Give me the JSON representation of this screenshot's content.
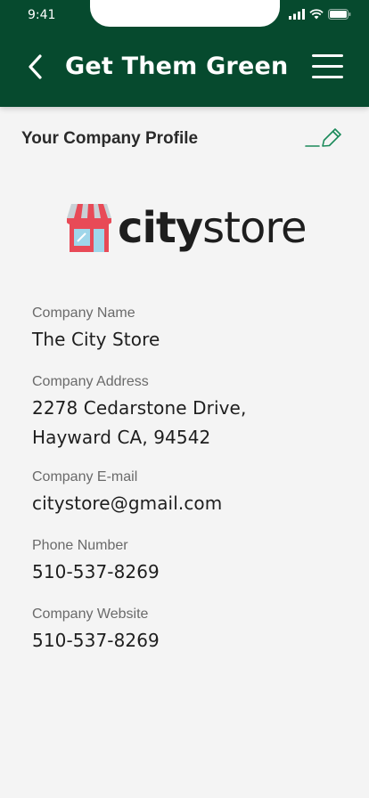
{
  "status_bar": {
    "time": "9:41"
  },
  "header": {
    "title": "Get Them Green",
    "background_color": "#064a2e"
  },
  "profile": {
    "section_title": "Your Company Profile",
    "accent_color": "#1b8a5a"
  },
  "logo": {
    "text_bold": "city",
    "text_light": "store"
  },
  "fields": [
    {
      "label": "Company Name",
      "value": "The City Store"
    },
    {
      "label": "Company Address",
      "value": "2278 Cedarstone Drive, Hayward CA, 94542"
    },
    {
      "label": "Company E-mail",
      "value": "citystore@gmail.com"
    },
    {
      "label": "Phone Number",
      "value": "510-537-8269"
    },
    {
      "label": "Company Website",
      "value": "510-537-8269"
    }
  ]
}
